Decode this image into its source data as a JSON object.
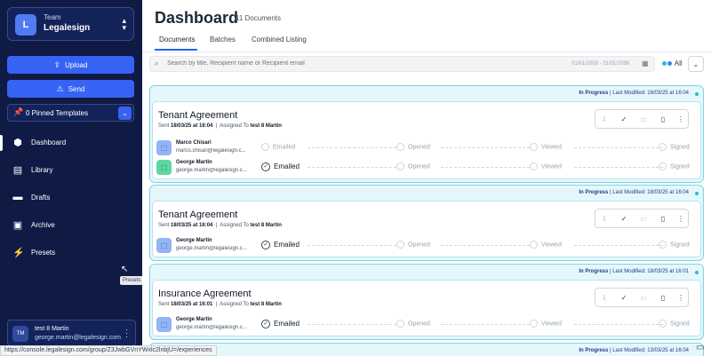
{
  "sidebar": {
    "team_label": "Team",
    "team_name": "Legalesign",
    "team_initial": "L",
    "upload_label": "Upload",
    "send_label": "Send",
    "pinned_label": "0 Pinned Templates",
    "nav": [
      {
        "label": "Dashboard",
        "icon": "dashboard-icon"
      },
      {
        "label": "Library",
        "icon": "library-icon"
      },
      {
        "label": "Drafts",
        "icon": "drafts-icon"
      },
      {
        "label": "Archive",
        "icon": "archive-icon"
      },
      {
        "label": "Presets",
        "icon": "presets-icon"
      }
    ],
    "tooltip": "Presets",
    "user": {
      "initials": "TM",
      "name": "test 8 Martin",
      "email": "george.martin@legalesign.com"
    }
  },
  "header": {
    "title": "Dashboard",
    "count": "11 Documents",
    "tabs": [
      "Documents",
      "Batches",
      "Combined Listing"
    ]
  },
  "search": {
    "placeholder": "Search by title, Recipient name or Recipient email",
    "date_range": "01/01/2000 - 01/01/2099",
    "filter_label": "All"
  },
  "documents": [
    {
      "status": "In Progress",
      "modified": "Last Modified: 18/03/25 at 16:04",
      "title": "Tenant Agreement",
      "sent_prefix": "Sent",
      "sent": "18/03/25 at 16:04",
      "assigned_prefix": "Assigned To",
      "assigned": "test 8 Martin",
      "recipients": [
        {
          "name": "Marco Chisari",
          "email": "marco.chisari@legalesign.c...",
          "emailed_done": false
        },
        {
          "name": "George Martin",
          "email": "george.martin@legalesign.c...",
          "emailed_done": true
        }
      ]
    },
    {
      "status": "In Progress",
      "modified": "Last Modified: 18/03/25 at 16:04",
      "title": "Tenant Agreement",
      "sent_prefix": "Sent",
      "sent": "18/03/25 at 16:04",
      "assigned_prefix": "Assigned To",
      "assigned": "test 8 Martin",
      "recipients": [
        {
          "name": "George Martin",
          "email": "george.martin@legalesign.c...",
          "emailed_done": true
        }
      ]
    },
    {
      "status": "In Progress",
      "modified": "Last Modified: 18/03/25 at 16:01",
      "title": "Insurance Agreement",
      "sent_prefix": "Sent",
      "sent": "18/03/25 at 16:01",
      "assigned_prefix": "Assigned To",
      "assigned": "test 8 Martin",
      "recipients": [
        {
          "name": "George Martin",
          "email": "george.martin@legalesign.c...",
          "emailed_done": true
        }
      ]
    }
  ],
  "steps": [
    "Emailed",
    "Opened",
    "Viewed",
    "Signed"
  ],
  "fourth_card": {
    "status": "In Progress",
    "modified": "Last Modified: 13/03/25 at 16:04"
  },
  "status_url": "https://console.legalesign.com/group/Z3JwbGVnYWxlc2lnbjU=/experiences"
}
